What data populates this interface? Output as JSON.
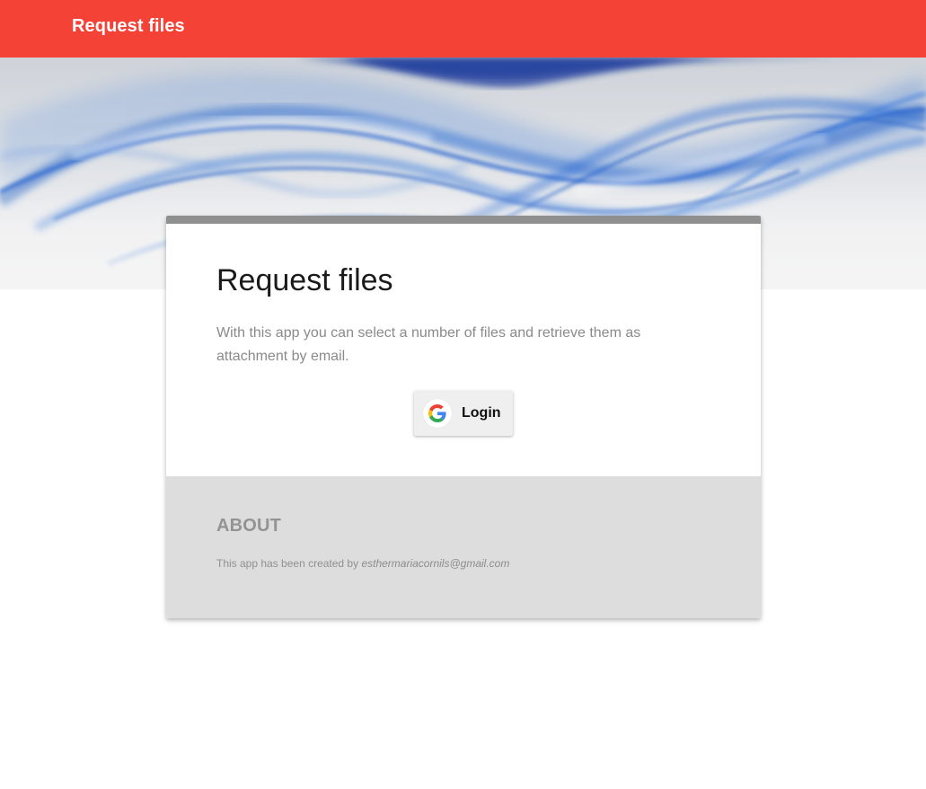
{
  "appbar": {
    "title": "Request files",
    "color": "#f44336"
  },
  "hero": {
    "image": "abstract-blue-waves"
  },
  "card": {
    "title": "Request files",
    "description": "With this app you can select a number of files and retrieve them as attachment by email.",
    "login_button": {
      "icon": "google-icon",
      "label": "Login"
    },
    "about": {
      "heading": "ABOUT",
      "text_prefix": "This app has been created by ",
      "email": "esthermariacornils@gmail.com"
    }
  }
}
